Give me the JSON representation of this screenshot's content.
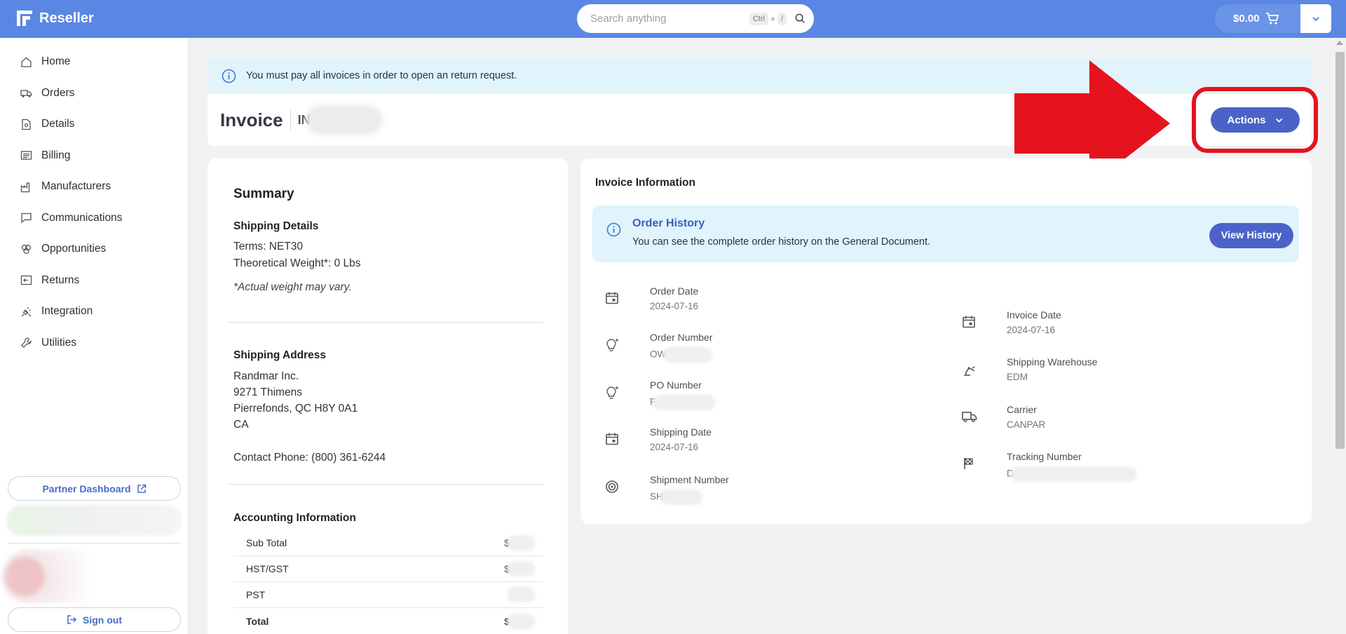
{
  "header": {
    "brand": "Reseller",
    "search_placeholder": "Search anything",
    "kbd_ctrl": "Ctrl",
    "kbd_plus": "+",
    "kbd_slash": "/",
    "cart_total": "$0.00"
  },
  "sidebar": {
    "items": [
      {
        "label": "Home",
        "icon": "home-icon"
      },
      {
        "label": "Orders",
        "icon": "truck-icon"
      },
      {
        "label": "Details",
        "icon": "document-icon"
      },
      {
        "label": "Billing",
        "icon": "billing-icon"
      },
      {
        "label": "Manufacturers",
        "icon": "factory-icon"
      },
      {
        "label": "Communications",
        "icon": "chat-icon"
      },
      {
        "label": "Opportunities",
        "icon": "opportunities-icon"
      },
      {
        "label": "Returns",
        "icon": "returns-icon"
      },
      {
        "label": "Integration",
        "icon": "plug-icon"
      },
      {
        "label": "Utilities",
        "icon": "wrench-icon"
      }
    ],
    "partner_dashboard": "Partner Dashboard",
    "sign_out": "Sign out"
  },
  "alert": {
    "text": "You must pay all invoices in order to open an return request."
  },
  "invoice": {
    "title": "Invoice",
    "number_prefix": "IN",
    "actions_label": "Actions"
  },
  "summary": {
    "title": "Summary",
    "shipping_details": {
      "heading": "Shipping Details",
      "terms": "Terms: NET30",
      "weight": "Theoretical Weight*: 0 Lbs",
      "note": "*Actual weight may vary."
    },
    "shipping_address": {
      "heading": "Shipping Address",
      "line1": "Randmar Inc.",
      "line2": "9271 Thimens",
      "line3": "Pierrefonds, QC H8Y 0A1",
      "line4": "CA",
      "phone": "Contact Phone: (800) 361-6244"
    },
    "accounting": {
      "heading": "Accounting Information",
      "rows": [
        {
          "label": "Sub Total",
          "value": "$"
        },
        {
          "label": "HST/GST",
          "value": "$"
        },
        {
          "label": "PST",
          "value": ""
        },
        {
          "label": "Total",
          "value": "$"
        }
      ]
    }
  },
  "invoice_info": {
    "title": "Invoice Information",
    "order_history": {
      "title": "Order History",
      "text": "You can see the complete order history on the General Document.",
      "button": "View History"
    },
    "left_fields": [
      {
        "label": "Order Date",
        "value": "2024-07-16",
        "icon": "calendar-icon"
      },
      {
        "label": "Order Number",
        "value": "OW",
        "icon": "bulb-icon"
      },
      {
        "label": "PO Number",
        "value": "F",
        "icon": "bulb-icon"
      },
      {
        "label": "Shipping Date",
        "value": "2024-07-16",
        "icon": "calendar-icon"
      },
      {
        "label": "Shipment Number",
        "value": "SH",
        "icon": "target-icon"
      }
    ],
    "right_fields": [
      {
        "label": "Invoice Date",
        "value": "2024-07-16",
        "icon": "calendar-icon"
      },
      {
        "label": "Shipping Warehouse",
        "value": "EDM",
        "icon": "robot-arm-icon"
      },
      {
        "label": "Carrier",
        "value": "CANPAR",
        "icon": "truck-icon"
      },
      {
        "label": "Tracking Number",
        "value": "D",
        "icon": "flag-icon"
      }
    ]
  },
  "colors": {
    "header_bg": "#5a87e3",
    "primary_button": "#4b63c8",
    "alert_bg": "#e1f3fb",
    "highlight": "#e5131e"
  }
}
